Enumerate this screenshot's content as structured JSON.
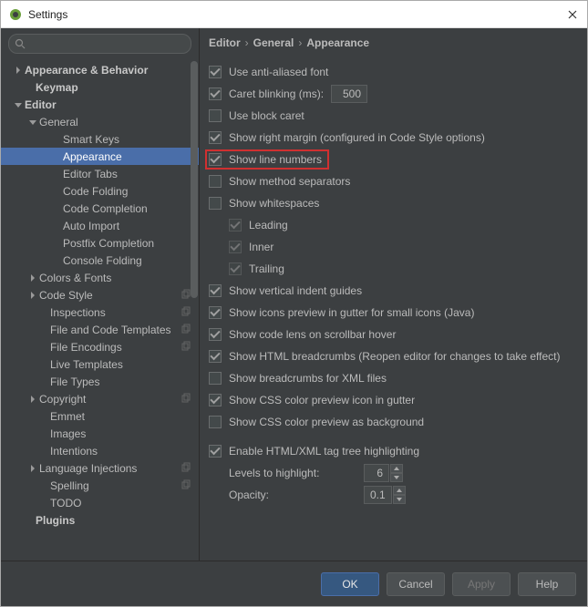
{
  "window": {
    "title": "Settings"
  },
  "search": {
    "placeholder": ""
  },
  "sidebar": {
    "items": [
      {
        "label": "Appearance & Behavior",
        "indent": 14,
        "arrow": "right",
        "bold": true
      },
      {
        "label": "Keymap",
        "indent": 26,
        "arrow": "",
        "bold": true
      },
      {
        "label": "Editor",
        "indent": 14,
        "arrow": "down",
        "bold": true
      },
      {
        "label": "General",
        "indent": 30,
        "arrow": "down"
      },
      {
        "label": "Smart Keys",
        "indent": 56,
        "arrow": ""
      },
      {
        "label": "Appearance",
        "indent": 56,
        "arrow": "",
        "selected": true
      },
      {
        "label": "Editor Tabs",
        "indent": 56,
        "arrow": ""
      },
      {
        "label": "Code Folding",
        "indent": 56,
        "arrow": ""
      },
      {
        "label": "Code Completion",
        "indent": 56,
        "arrow": ""
      },
      {
        "label": "Auto Import",
        "indent": 56,
        "arrow": ""
      },
      {
        "label": "Postfix Completion",
        "indent": 56,
        "arrow": ""
      },
      {
        "label": "Console Folding",
        "indent": 56,
        "arrow": ""
      },
      {
        "label": "Colors & Fonts",
        "indent": 30,
        "arrow": "right"
      },
      {
        "label": "Code Style",
        "indent": 30,
        "arrow": "right",
        "copy": true
      },
      {
        "label": "Inspections",
        "indent": 42,
        "arrow": "",
        "copy": true
      },
      {
        "label": "File and Code Templates",
        "indent": 42,
        "arrow": "",
        "copy": true
      },
      {
        "label": "File Encodings",
        "indent": 42,
        "arrow": "",
        "copy": true
      },
      {
        "label": "Live Templates",
        "indent": 42,
        "arrow": ""
      },
      {
        "label": "File Types",
        "indent": 42,
        "arrow": ""
      },
      {
        "label": "Copyright",
        "indent": 30,
        "arrow": "right",
        "copy": true
      },
      {
        "label": "Emmet",
        "indent": 42,
        "arrow": ""
      },
      {
        "label": "Images",
        "indent": 42,
        "arrow": ""
      },
      {
        "label": "Intentions",
        "indent": 42,
        "arrow": ""
      },
      {
        "label": "Language Injections",
        "indent": 30,
        "arrow": "right",
        "copy": true
      },
      {
        "label": "Spelling",
        "indent": 42,
        "arrow": "",
        "copy": true
      },
      {
        "label": "TODO",
        "indent": 42,
        "arrow": ""
      },
      {
        "label": "Plugins",
        "indent": 26,
        "arrow": "",
        "bold": true
      }
    ]
  },
  "breadcrumb": {
    "a": "Editor",
    "b": "General",
    "c": "Appearance"
  },
  "options": {
    "antialiased": "Use anti-aliased font",
    "caret_blink": "Caret blinking (ms):",
    "caret_blink_val": "500",
    "block_caret": "Use block caret",
    "right_margin": "Show right margin (configured in Code Style options)",
    "line_numbers": "Show line numbers",
    "method_sep": "Show method separators",
    "whitespace": "Show whitespaces",
    "ws_leading": "Leading",
    "ws_inner": "Inner",
    "ws_trailing": "Trailing",
    "vguides": "Show vertical indent guides",
    "icons_preview": "Show icons preview in gutter for small icons (Java)",
    "code_lens": "Show code lens on scrollbar hover",
    "html_bc": "Show HTML breadcrumbs (Reopen editor for changes to take effect)",
    "xml_bc": "Show breadcrumbs for XML files",
    "css_color_gutter": "Show CSS color preview icon in gutter",
    "css_color_bg": "Show CSS color preview as background",
    "tag_tree": "Enable HTML/XML tag tree highlighting",
    "levels_label": "Levels to highlight:",
    "levels_val": "6",
    "opacity_label": "Opacity:",
    "opacity_val": "0.1"
  },
  "buttons": {
    "ok": "OK",
    "cancel": "Cancel",
    "apply": "Apply",
    "help": "Help"
  }
}
